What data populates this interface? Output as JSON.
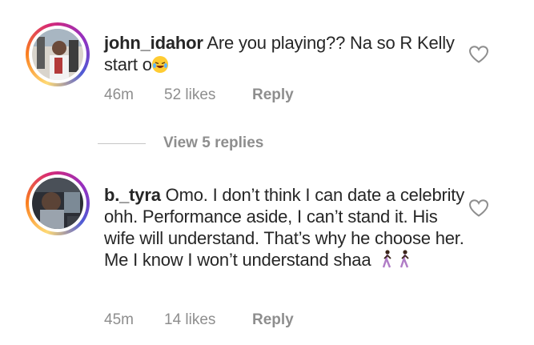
{
  "comments": [
    {
      "username": "john_idahor",
      "text_before_emoji": "Are you playing?? Na so R Kelly start o",
      "emoji": "laughing-tears-emoji",
      "time": "46m",
      "likes": "52 likes",
      "reply_label": "Reply"
    },
    {
      "username": "b._tyra",
      "text": "Omo. I don’t think I can date a celebrity ohh. Performance aside, I can’t stand it. His wife will understand. That’s why he choose her. Me I know I won’t understand shaa",
      "emoji": "person-walking-emoji",
      "time": "45m",
      "likes": "14 likes",
      "reply_label": "Reply"
    }
  ],
  "view_replies_label": "View 5 replies",
  "colors": {
    "text": "#262626",
    "meta": "#8e8e8e",
    "divider": "#c7c7c7"
  }
}
